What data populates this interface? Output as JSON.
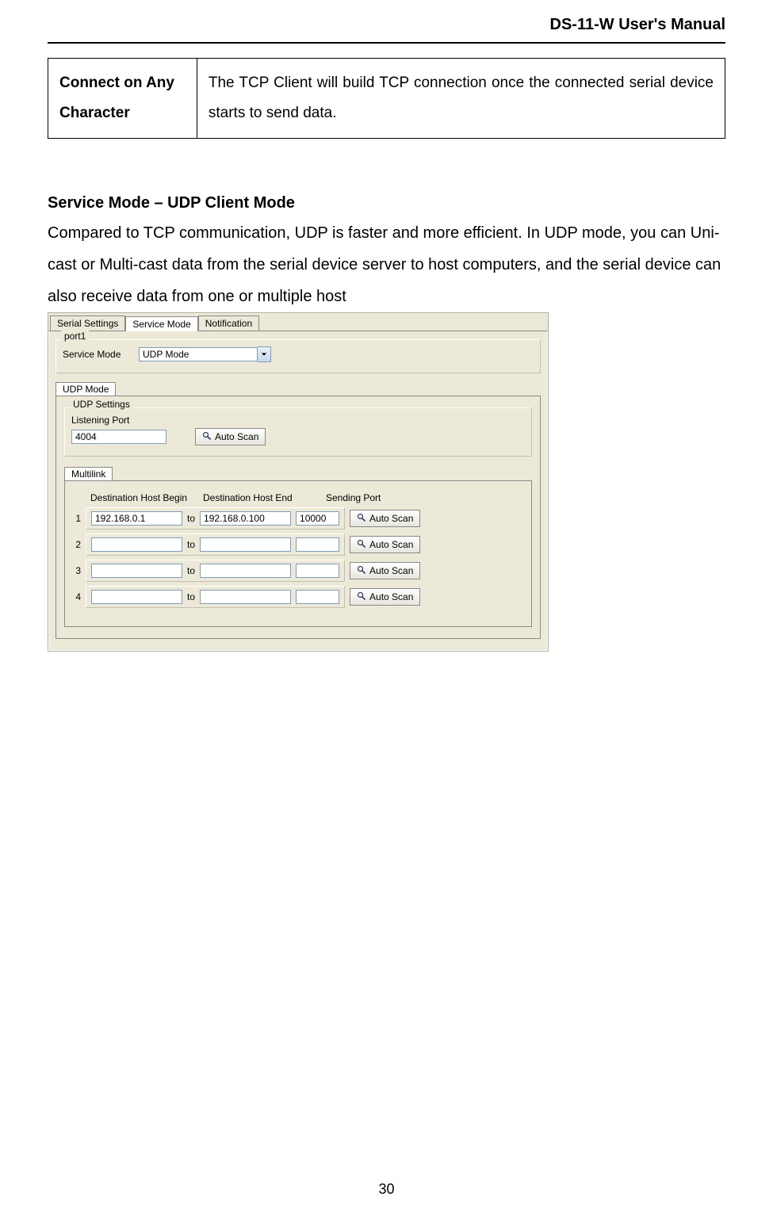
{
  "header": {
    "manual_title": "DS-11-W User's Manual"
  },
  "table": {
    "label": "Connect on Any Character",
    "desc": "The TCP Client will build TCP connection once the connected serial device starts to send data."
  },
  "section": {
    "title": "Service Mode – UDP Client Mode",
    "body": "Compared to TCP communication, UDP is faster and more efficient.    In UDP mode, you can Uni-cast or Multi-cast data from the serial device server to host computers, and the serial device can also receive data from one or multiple host"
  },
  "ui": {
    "top_tabs": {
      "serial": "Serial Settings",
      "service": "Service Mode",
      "notification": "Notification"
    },
    "port_group": "port1",
    "service_mode_label": "Service Mode",
    "service_mode_value": "UDP Mode",
    "mode_tab": "UDP Mode",
    "udp_group": "UDP Settings",
    "listening_port_label": "Listening Port",
    "listening_port_value": "4004",
    "auto_scan": "Auto Scan",
    "multilink_tab": "Multilink",
    "headers": {
      "begin": "Destination Host Begin",
      "end": "Destination Host End",
      "port": "Sending Port"
    },
    "rows": [
      {
        "n": "1",
        "begin": "192.168.0.1",
        "end": "192.168.0.100",
        "port": "10000"
      },
      {
        "n": "2",
        "begin": "",
        "end": "",
        "port": ""
      },
      {
        "n": "3",
        "begin": "",
        "end": "",
        "port": ""
      },
      {
        "n": "4",
        "begin": "",
        "end": "",
        "port": ""
      }
    ],
    "to": "to"
  },
  "page_number": "30"
}
